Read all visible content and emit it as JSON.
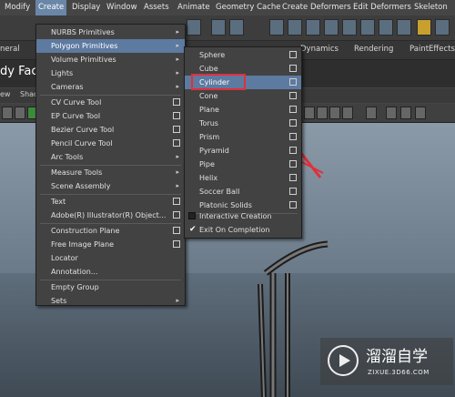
{
  "menubar": {
    "items": [
      "Modify",
      "Create",
      "Display",
      "Window",
      "Assets",
      "Animate",
      "Geometry Cache",
      "Create Deformers",
      "Edit Deformers",
      "Skeleton"
    ],
    "active_index": 1
  },
  "shelf_tabs": [
    "neral",
    "Dynamics",
    "Rendering",
    "PaintEffects"
  ],
  "status": {
    "face_label": "dy Face"
  },
  "panel_menu": [
    "ew",
    "Shac"
  ],
  "create_menu": {
    "items": [
      {
        "label": "NURBS Primitives",
        "kind": "submenu"
      },
      {
        "label": "Polygon Primitives",
        "kind": "submenu",
        "highlight": true
      },
      {
        "label": "Volume Primitives",
        "kind": "submenu"
      },
      {
        "label": "Lights",
        "kind": "submenu"
      },
      {
        "label": "Cameras",
        "kind": "submenu"
      },
      {
        "label": "CV Curve Tool",
        "kind": "option"
      },
      {
        "label": "EP Curve Tool",
        "kind": "option"
      },
      {
        "label": "Bezier Curve Tool",
        "kind": "option"
      },
      {
        "label": "Pencil Curve Tool",
        "kind": "option"
      },
      {
        "label": "Arc Tools",
        "kind": "submenu"
      },
      {
        "label": "Measure Tools",
        "kind": "submenu"
      },
      {
        "label": "Scene Assembly",
        "kind": "submenu"
      },
      {
        "label": "Text",
        "kind": "option"
      },
      {
        "label": "Adobe(R) Illustrator(R) Object...",
        "kind": "option"
      },
      {
        "label": "Construction Plane",
        "kind": "option"
      },
      {
        "label": "Free Image Plane",
        "kind": "option"
      },
      {
        "label": "Locator",
        "kind": "plain"
      },
      {
        "label": "Annotation...",
        "kind": "plain"
      },
      {
        "label": "Empty Group",
        "kind": "plain"
      },
      {
        "label": "Sets",
        "kind": "submenu"
      }
    ]
  },
  "poly_menu": {
    "items": [
      {
        "label": "Sphere"
      },
      {
        "label": "Cube"
      },
      {
        "label": "Cylinder",
        "highlight": true
      },
      {
        "label": "Cone"
      },
      {
        "label": "Plane"
      },
      {
        "label": "Torus"
      },
      {
        "label": "Prism"
      },
      {
        "label": "Pyramid"
      },
      {
        "label": "Pipe"
      },
      {
        "label": "Helix"
      },
      {
        "label": "Soccer Ball"
      },
      {
        "label": "Platonic Solids"
      }
    ],
    "toggles": [
      {
        "label": "Interactive Creation",
        "checked": false
      },
      {
        "label": "Exit On Completion",
        "checked": true
      }
    ]
  },
  "watermark": {
    "title": "溜溜自学",
    "url": "ZIXUE.3D66.COM"
  },
  "colors": {
    "highlight": "#5d7aa0",
    "annotation": "#e0303a"
  }
}
